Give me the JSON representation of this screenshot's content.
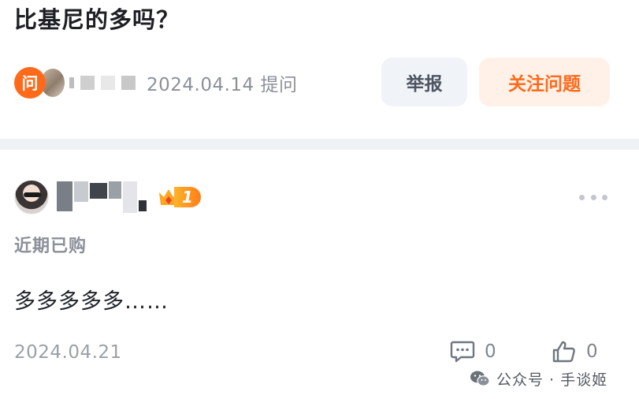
{
  "question": {
    "title": "比基尼的多吗？",
    "ask_badge": "问",
    "ask_date": "2024.04.14",
    "ask_label": "提问",
    "report_label": "举报",
    "follow_label": "关注问题"
  },
  "answer": {
    "level": "1",
    "purchase_tag": "近期已购",
    "body": "多多多多多……",
    "date": "2024.04.21",
    "comment_count": "0",
    "like_count": "0"
  },
  "watermark": {
    "text": "公众号 · 手谈姬"
  },
  "colors": {
    "accent": "#ff6a1a",
    "accent_soft": "#fff1e8",
    "muted_text": "#8b9099",
    "divider": "#eef1f5"
  }
}
